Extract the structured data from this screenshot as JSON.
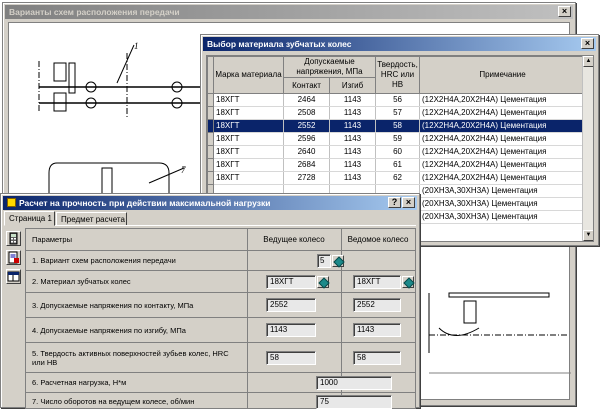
{
  "schemes_window": {
    "title": "Варианты схем расположения передачи",
    "diagram_label_top": "1",
    "diagram_label_bottom": "7"
  },
  "material_window": {
    "title": "Выбор материала зубчатых колес",
    "columns": {
      "material": "Марка материала",
      "stress_group": "Допускаемые напряжения, МПа",
      "contact": "Контакт",
      "bending": "Изгиб",
      "hardness": "Твердость, HRC или HB",
      "note": "Примечание"
    },
    "rows": [
      {
        "material": "18ХГТ",
        "contact": "2464",
        "bending": "1143",
        "hardness": "56",
        "note": "(12Х2Н4А,20Х2Н4А) Цементация"
      },
      {
        "material": "18ХГТ",
        "contact": "2508",
        "bending": "1143",
        "hardness": "57",
        "note": "(12Х2Н4А,20Х2Н4А) Цементация"
      },
      {
        "material": "18ХГТ",
        "contact": "2552",
        "bending": "1143",
        "hardness": "58",
        "note": "(12Х2Н4А,20Х2Н4А) Цементация"
      },
      {
        "material": "18ХГТ",
        "contact": "2596",
        "bending": "1143",
        "hardness": "59",
        "note": "(12Х2Н4А,20Х2Н4А) Цементация"
      },
      {
        "material": "18ХГТ",
        "contact": "2640",
        "bending": "1143",
        "hardness": "60",
        "note": "(12Х2Н4А,20Х2Н4А) Цементация"
      },
      {
        "material": "18ХГТ",
        "contact": "2684",
        "bending": "1143",
        "hardness": "61",
        "note": "(12Х2Н4А,20Х2Н4А) Цементация"
      },
      {
        "material": "18ХГТ",
        "contact": "2728",
        "bending": "1143",
        "hardness": "62",
        "note": "(12Х2Н4А,20Х2Н4А) Цементация"
      },
      {
        "material": "",
        "contact": "",
        "bending": "",
        "hardness": "",
        "note": "(20ХН3А,30ХН3А) Цементация"
      },
      {
        "material": "",
        "contact": "",
        "bending": "",
        "hardness": "",
        "note": "(20ХН3А,30ХН3А) Цементация"
      },
      {
        "material": "",
        "contact": "",
        "bending": "",
        "hardness": "",
        "note": "(20ХН3А,30ХН3А) Цементация"
      }
    ],
    "selected_row": 2
  },
  "calc_window": {
    "title": "Расчет на прочность при действии максимальной нагрузки",
    "tabs": [
      "Страница 1",
      "Предмет расчета"
    ],
    "header": {
      "params": "Параметры",
      "drive": "Ведущее колесо",
      "driven": "Ведомое колесо"
    },
    "rows": {
      "scheme": {
        "label": "1. Вариант схем расположения передачи",
        "value": "5"
      },
      "material": {
        "label": "2. Материал зубчатых колес",
        "drive": "18ХГТ",
        "driven": "18ХГТ"
      },
      "contact": {
        "label": "3. Допускаемые напряжения по контакту, МПа",
        "drive": "2552",
        "driven": "2552"
      },
      "bending": {
        "label": "4. Допускаемые напряжения по изгибу, МПа",
        "drive": "1143",
        "driven": "1143"
      },
      "hardness": {
        "label": "5. Твердость активных поверхностей зубьев колес, HRC или HB",
        "drive": "58",
        "driven": "58"
      },
      "load": {
        "label": "6. Расчетная нагрузка, Н*м",
        "value": "1000"
      },
      "rpm": {
        "label": "7. Число оборотов на ведущем колесе, об/мин",
        "value": "75"
      }
    }
  },
  "colors": {
    "title_active": "#0a246a",
    "title_inactive": "#808080",
    "selection": "#0a246a",
    "face": "#d4d0c8"
  }
}
